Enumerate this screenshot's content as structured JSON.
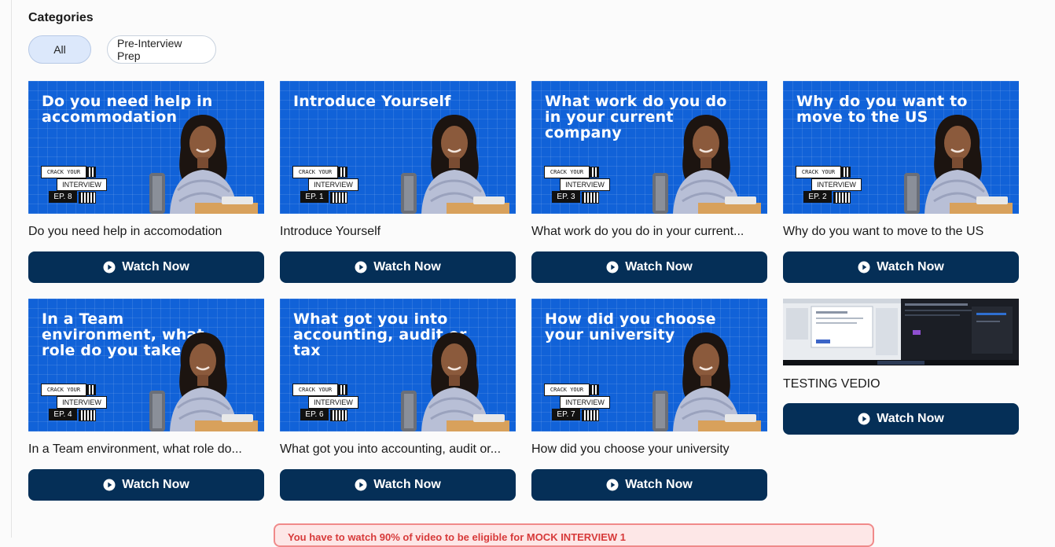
{
  "categories": {
    "title": "Categories",
    "chips": [
      {
        "label": "All",
        "active": true
      },
      {
        "label": "Pre-Interview Prep",
        "active": false
      }
    ]
  },
  "badge": {
    "line1": "CRACK YOUR",
    "line2": "INTERVIEW"
  },
  "cards": [
    {
      "thumb_title": "Do you need help in accommodation",
      "episode": "EP. 8",
      "title": "Do you need help in accomodation",
      "button": "Watch Now"
    },
    {
      "thumb_title": "Introduce Yourself",
      "episode": "EP. 1",
      "title": "Introduce Yourself",
      "button": "Watch Now"
    },
    {
      "thumb_title": "What work do you do in your current company",
      "episode": "EP. 3",
      "title": "What work do you do in your current...",
      "button": "Watch Now"
    },
    {
      "thumb_title": "Why do you want to move to the US",
      "episode": "EP. 2",
      "title": "Why do you want to move to the US",
      "button": "Watch Now"
    },
    {
      "thumb_title": "In a Team environment, what role do you take on",
      "episode": "EP. 4",
      "title": "In a Team environment, what role do...",
      "button": "Watch Now"
    },
    {
      "thumb_title": "What got you into accounting, audit or tax",
      "episode": "EP. 6",
      "title": "What got you into accounting, audit or...",
      "button": "Watch Now"
    },
    {
      "thumb_title": "How did you choose your university",
      "episode": "EP. 7",
      "title": "How did you choose your university",
      "button": "Watch Now"
    }
  ],
  "test_card": {
    "title": "TESTING VEDIO",
    "button": "Watch Now"
  },
  "notice": "You have to watch 90% of video to be eligible for MOCK INTERVIEW 1",
  "colors": {
    "thumb_blue": "#1162d8",
    "button_navy": "#052f57",
    "chip_active": "#dce8fb",
    "notice_red": "#d73a3a"
  }
}
